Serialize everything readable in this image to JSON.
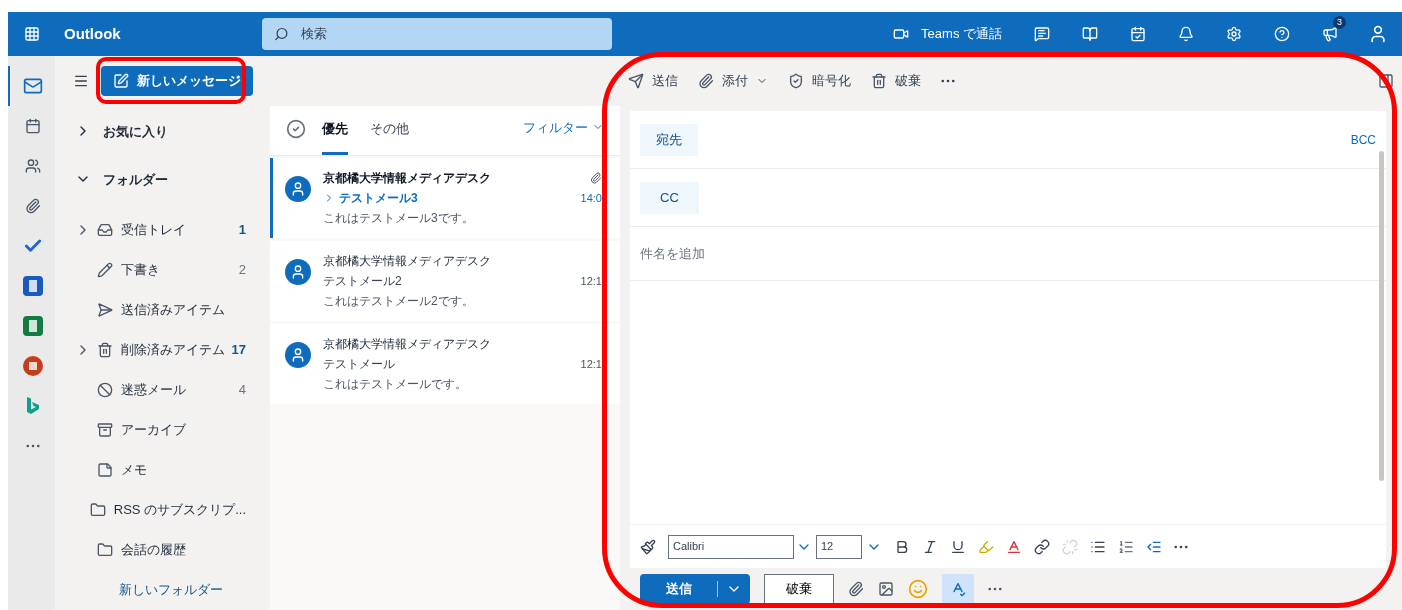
{
  "header": {
    "app_name": "Outlook",
    "search_placeholder": "検索",
    "teams_call": "Teams で通話",
    "notification_count": "3"
  },
  "rail": [
    {
      "kind": "mail",
      "selected": true
    },
    {
      "kind": "calendar",
      "selected": false
    },
    {
      "kind": "people",
      "selected": false
    },
    {
      "kind": "files",
      "selected": false
    },
    {
      "kind": "todo",
      "selected": false
    },
    {
      "kind": "word",
      "selected": false
    },
    {
      "kind": "excel",
      "selected": false
    },
    {
      "kind": "powerpoint",
      "selected": false
    },
    {
      "kind": "bing",
      "selected": false
    },
    {
      "kind": "more",
      "selected": false
    }
  ],
  "new_message": "新しいメッセージ",
  "folder_pane": {
    "favorites": {
      "label": "お気に入り",
      "expanded": false
    },
    "folders": {
      "label": "フォルダー",
      "expanded": true
    },
    "items": [
      {
        "kind": "inbox",
        "label": "受信トレイ",
        "count": "1",
        "unread": true,
        "expandable": true
      },
      {
        "kind": "drafts",
        "label": "下書き",
        "count": "2",
        "unread": false,
        "expandable": false
      },
      {
        "kind": "sent",
        "label": "送信済みアイテム",
        "expandable": false
      },
      {
        "kind": "deleted",
        "label": "削除済みアイテム",
        "count": "17",
        "unread": true,
        "expandable": true
      },
      {
        "kind": "junk",
        "label": "迷惑メール",
        "count": "4",
        "unread": false,
        "expandable": false
      },
      {
        "kind": "archive",
        "label": "アーカイブ",
        "expandable": false
      },
      {
        "kind": "notes",
        "label": "メモ",
        "expandable": false
      },
      {
        "kind": "folder",
        "label": "RSS のサブスクリプ...",
        "expandable": false
      },
      {
        "kind": "folder",
        "label": "会話の履歴",
        "expandable": false
      }
    ],
    "new_folder": "新しいフォルダー"
  },
  "message_list": {
    "tabs": [
      {
        "label": "優先",
        "selected": true
      },
      {
        "label": "その他",
        "selected": false
      }
    ],
    "filter": "フィルター",
    "messages": [
      {
        "sender": "京都橘大学情報メディアデスク",
        "subject": "テストメール3",
        "preview": "これはテストメール3です。",
        "time": "14:0",
        "unread": true,
        "selected": true,
        "attachment": true
      },
      {
        "sender": "京都橘大学情報メディアデスク",
        "subject": "テストメール2",
        "preview": "これはテストメール2です。",
        "time": "12:1",
        "unread": false,
        "selected": false,
        "attachment": false
      },
      {
        "sender": "京都橘大学情報メディアデスク",
        "subject": "テストメール",
        "preview": "これはテストメールです。",
        "time": "12:1",
        "unread": false,
        "selected": false,
        "attachment": false
      }
    ]
  },
  "compose": {
    "commands": [
      {
        "kind": "send",
        "label": "送信"
      },
      {
        "kind": "attach",
        "label": "添付"
      },
      {
        "kind": "encrypt",
        "label": "暗号化"
      },
      {
        "kind": "discard",
        "label": "破棄"
      }
    ],
    "to_label": "宛先",
    "bcc": "BCC",
    "cc_label": "CC",
    "subject_placeholder": "件名を追加",
    "font": "Calibri",
    "font_size": "12",
    "send": "送信",
    "discard": "破棄"
  }
}
